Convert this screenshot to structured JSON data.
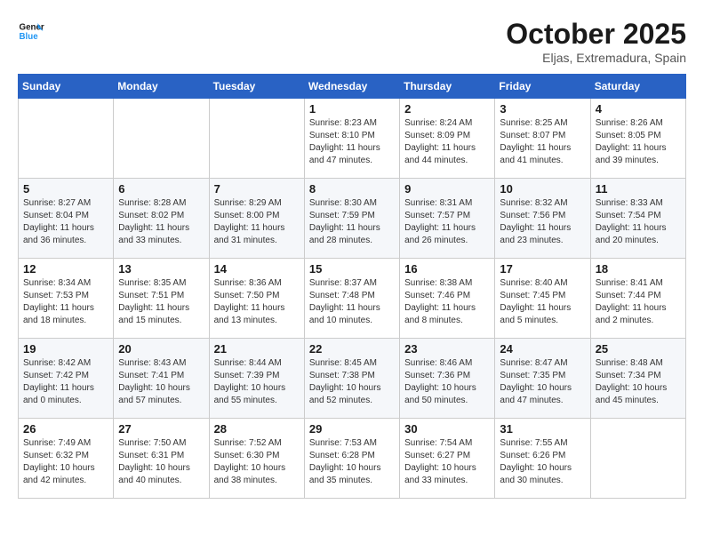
{
  "header": {
    "logo_line1": "General",
    "logo_line2": "Blue",
    "title": "October 2025",
    "location": "Eljas, Extremadura, Spain"
  },
  "weekdays": [
    "Sunday",
    "Monday",
    "Tuesday",
    "Wednesday",
    "Thursday",
    "Friday",
    "Saturday"
  ],
  "weeks": [
    [
      {
        "day": "",
        "info": ""
      },
      {
        "day": "",
        "info": ""
      },
      {
        "day": "",
        "info": ""
      },
      {
        "day": "1",
        "info": "Sunrise: 8:23 AM\nSunset: 8:10 PM\nDaylight: 11 hours\nand 47 minutes."
      },
      {
        "day": "2",
        "info": "Sunrise: 8:24 AM\nSunset: 8:09 PM\nDaylight: 11 hours\nand 44 minutes."
      },
      {
        "day": "3",
        "info": "Sunrise: 8:25 AM\nSunset: 8:07 PM\nDaylight: 11 hours\nand 41 minutes."
      },
      {
        "day": "4",
        "info": "Sunrise: 8:26 AM\nSunset: 8:05 PM\nDaylight: 11 hours\nand 39 minutes."
      }
    ],
    [
      {
        "day": "5",
        "info": "Sunrise: 8:27 AM\nSunset: 8:04 PM\nDaylight: 11 hours\nand 36 minutes."
      },
      {
        "day": "6",
        "info": "Sunrise: 8:28 AM\nSunset: 8:02 PM\nDaylight: 11 hours\nand 33 minutes."
      },
      {
        "day": "7",
        "info": "Sunrise: 8:29 AM\nSunset: 8:00 PM\nDaylight: 11 hours\nand 31 minutes."
      },
      {
        "day": "8",
        "info": "Sunrise: 8:30 AM\nSunset: 7:59 PM\nDaylight: 11 hours\nand 28 minutes."
      },
      {
        "day": "9",
        "info": "Sunrise: 8:31 AM\nSunset: 7:57 PM\nDaylight: 11 hours\nand 26 minutes."
      },
      {
        "day": "10",
        "info": "Sunrise: 8:32 AM\nSunset: 7:56 PM\nDaylight: 11 hours\nand 23 minutes."
      },
      {
        "day": "11",
        "info": "Sunrise: 8:33 AM\nSunset: 7:54 PM\nDaylight: 11 hours\nand 20 minutes."
      }
    ],
    [
      {
        "day": "12",
        "info": "Sunrise: 8:34 AM\nSunset: 7:53 PM\nDaylight: 11 hours\nand 18 minutes."
      },
      {
        "day": "13",
        "info": "Sunrise: 8:35 AM\nSunset: 7:51 PM\nDaylight: 11 hours\nand 15 minutes."
      },
      {
        "day": "14",
        "info": "Sunrise: 8:36 AM\nSunset: 7:50 PM\nDaylight: 11 hours\nand 13 minutes."
      },
      {
        "day": "15",
        "info": "Sunrise: 8:37 AM\nSunset: 7:48 PM\nDaylight: 11 hours\nand 10 minutes."
      },
      {
        "day": "16",
        "info": "Sunrise: 8:38 AM\nSunset: 7:46 PM\nDaylight: 11 hours\nand 8 minutes."
      },
      {
        "day": "17",
        "info": "Sunrise: 8:40 AM\nSunset: 7:45 PM\nDaylight: 11 hours\nand 5 minutes."
      },
      {
        "day": "18",
        "info": "Sunrise: 8:41 AM\nSunset: 7:44 PM\nDaylight: 11 hours\nand 2 minutes."
      }
    ],
    [
      {
        "day": "19",
        "info": "Sunrise: 8:42 AM\nSunset: 7:42 PM\nDaylight: 11 hours\nand 0 minutes."
      },
      {
        "day": "20",
        "info": "Sunrise: 8:43 AM\nSunset: 7:41 PM\nDaylight: 10 hours\nand 57 minutes."
      },
      {
        "day": "21",
        "info": "Sunrise: 8:44 AM\nSunset: 7:39 PM\nDaylight: 10 hours\nand 55 minutes."
      },
      {
        "day": "22",
        "info": "Sunrise: 8:45 AM\nSunset: 7:38 PM\nDaylight: 10 hours\nand 52 minutes."
      },
      {
        "day": "23",
        "info": "Sunrise: 8:46 AM\nSunset: 7:36 PM\nDaylight: 10 hours\nand 50 minutes."
      },
      {
        "day": "24",
        "info": "Sunrise: 8:47 AM\nSunset: 7:35 PM\nDaylight: 10 hours\nand 47 minutes."
      },
      {
        "day": "25",
        "info": "Sunrise: 8:48 AM\nSunset: 7:34 PM\nDaylight: 10 hours\nand 45 minutes."
      }
    ],
    [
      {
        "day": "26",
        "info": "Sunrise: 7:49 AM\nSunset: 6:32 PM\nDaylight: 10 hours\nand 42 minutes."
      },
      {
        "day": "27",
        "info": "Sunrise: 7:50 AM\nSunset: 6:31 PM\nDaylight: 10 hours\nand 40 minutes."
      },
      {
        "day": "28",
        "info": "Sunrise: 7:52 AM\nSunset: 6:30 PM\nDaylight: 10 hours\nand 38 minutes."
      },
      {
        "day": "29",
        "info": "Sunrise: 7:53 AM\nSunset: 6:28 PM\nDaylight: 10 hours\nand 35 minutes."
      },
      {
        "day": "30",
        "info": "Sunrise: 7:54 AM\nSunset: 6:27 PM\nDaylight: 10 hours\nand 33 minutes."
      },
      {
        "day": "31",
        "info": "Sunrise: 7:55 AM\nSunset: 6:26 PM\nDaylight: 10 hours\nand 30 minutes."
      },
      {
        "day": "",
        "info": ""
      }
    ]
  ]
}
